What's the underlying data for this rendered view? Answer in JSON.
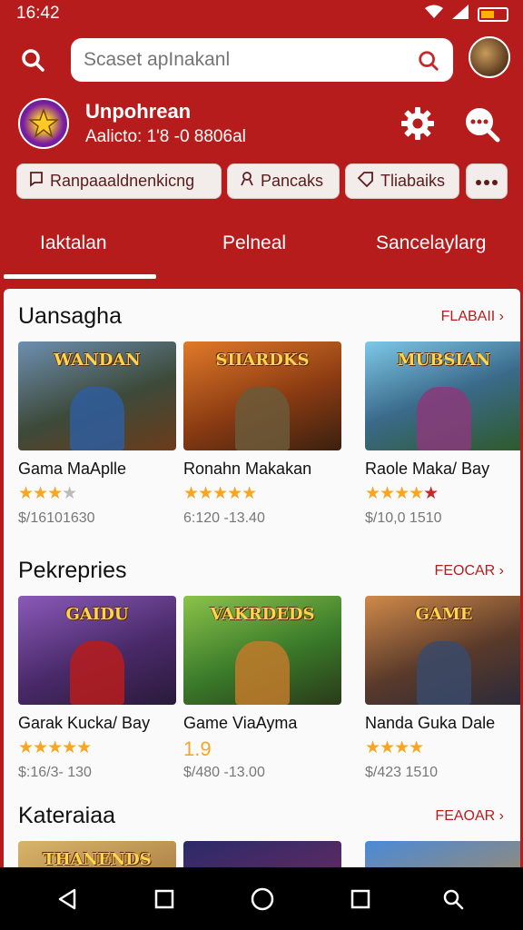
{
  "status_bar": {
    "time": "16:42"
  },
  "search": {
    "placeholder": "Scaset apInakanl"
  },
  "profile": {
    "name": "Unpohrean",
    "subtitle": "Aalicto: 1'8 -0 8806al"
  },
  "chips": [
    {
      "label": "Ranpaaaldnenkicng",
      "icon": "bookmark-icon"
    },
    {
      "label": "Pancaks",
      "icon": "user-icon"
    },
    {
      "label": "Tliabaiks",
      "icon": "tag-icon"
    }
  ],
  "tabs": [
    {
      "label": "Iaktalan",
      "active": true
    },
    {
      "label": "Pelneal",
      "active": false
    },
    {
      "label": "Sancelaylarg",
      "active": false
    }
  ],
  "sections": [
    {
      "title": "Uansagha",
      "more": "FLABAII",
      "cards": [
        {
          "title": "Gama MaAplle",
          "stars": 3,
          "price": "$/16101630",
          "badge": "WANDAN"
        },
        {
          "title": "Ronahn Makakan",
          "stars": 5,
          "price": "6:120 -13.40",
          "badge": "SIIARDKS"
        },
        {
          "title": "Raole Maka/ Bay",
          "stars": 4,
          "price": "$/10,0 1510",
          "badge": "MUBSIAN"
        }
      ]
    },
    {
      "title": "Pekrepries",
      "more": "FEOCAR",
      "cards": [
        {
          "title": "Garak Kucka/ Bay",
          "stars": 5,
          "price": "$:16/3- 130",
          "badge": "GAIDU"
        },
        {
          "title": "Game ViaAyma",
          "rating_text": "1.9",
          "price": "$/480 -13.00",
          "badge": "VAKRDEDS"
        },
        {
          "title": "Nanda Guka Dale",
          "stars": 4,
          "price": "$/423 1510",
          "badge": "GAME"
        }
      ]
    },
    {
      "title": "Kateraiaa",
      "more": "FEAOAR",
      "cards": [
        {
          "badge": "THANENDS"
        },
        {
          "badge": ""
        },
        {
          "badge": ""
        }
      ]
    }
  ],
  "colors": {
    "primary": "#b71c1c",
    "star": "#f5a623",
    "chip_bg": "#f2ecea"
  }
}
